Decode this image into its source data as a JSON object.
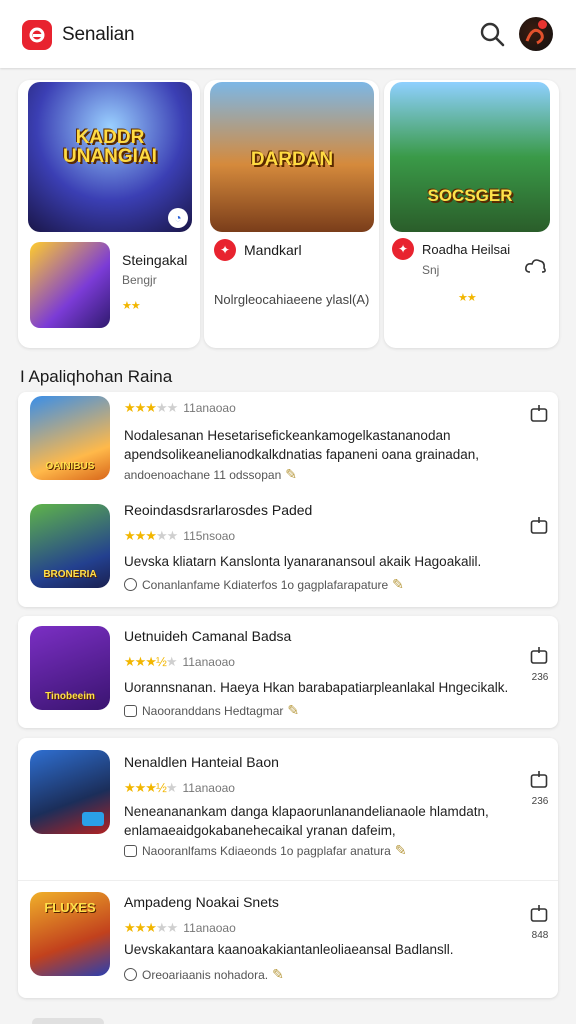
{
  "header": {
    "title": "Senalian"
  },
  "featured": [
    {
      "art_title": "KADDR\nUNANGIAI",
      "name": "Steingakal",
      "sub": "Bengjr",
      "stars": "★★",
      "desc": ""
    },
    {
      "art_title": "DARDAN",
      "name": "Mandkarl",
      "sub": "",
      "stars": "",
      "desc": "Nolrgleocahiaeene ylasl(A)"
    },
    {
      "art_title": "SOCSGER",
      "name": "Roadha Heilsai",
      "sub": "Snj",
      "stars": "★★",
      "desc": ""
    }
  ],
  "section_title": "I Apaliqhohan Raina",
  "list": [
    {
      "title": "",
      "stars_on": "★★★",
      "stars_off": "★★",
      "count": "11anaoao",
      "desc": "Nodalesanan Hesetarisefickeankamogelkastananodan apendsolikeanelianodkalkdnatias fapaneni oana grainadan,",
      "meta": "andoenoachane 11 odssopan",
      "icon_label": "OAINIBUS",
      "action_num": ""
    },
    {
      "title": "Reoindasdsrarlarosdes Paded",
      "stars_on": "★★★",
      "stars_off": "★★",
      "count": "115nsoao",
      "desc": "Uevska kliatarn Kanslonta lyanaranansoul akaik Hagoakalil.",
      "meta": "Conanlanfame Kdiaterfos 1o gagplafarapature",
      "icon_label": "BRONERIA",
      "action_num": ""
    },
    {
      "title": "Uetnuideh Camanal Badsa",
      "stars_on": "★★★½",
      "stars_off": "★",
      "count": "11anaoao",
      "desc": "Uorannsnanan. Haeya Hkan barabapatiarpleanlakal Hngecikalk.",
      "meta": "Naooranddans Hedtagmar",
      "icon_label": "Tinobeeim",
      "action_num": "236"
    },
    {
      "title": "Nenaldlen Hanteial Baon",
      "stars_on": "★★★½",
      "stars_off": "★",
      "count": "11anaoao",
      "desc": "Neneananankam danga klapaorunlanandelianaole hlamdatn, enlamaeaidgokabanehecaikal yranan dafeim,",
      "meta": "Naooranlfams Kdiaeonds 1o pagplafar anatura",
      "icon_label": "",
      "action_num": "236"
    },
    {
      "title": "Ampadeng Noakai Snets",
      "stars_on": "★★★",
      "stars_off": "★★",
      "count": "11anaoao",
      "desc": "Uevskakantara kaanoakakiantanleoliaeansal Badlansll.",
      "meta": "Oreoariaanis nohadora.",
      "icon_label": "FLUXES",
      "action_num": "848"
    }
  ]
}
